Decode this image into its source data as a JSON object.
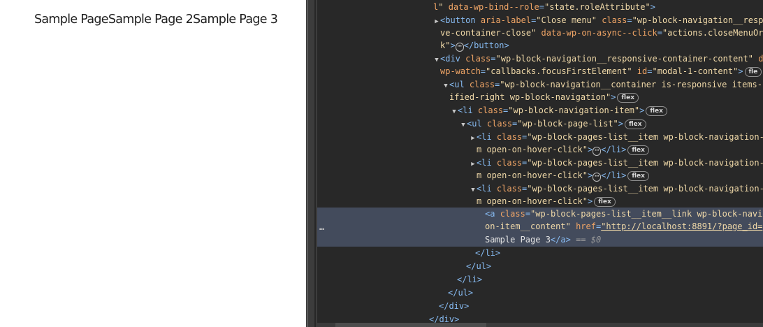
{
  "page_nav": {
    "items": [
      "Sample Page",
      "Sample Page 2",
      "Sample Page 3"
    ]
  },
  "devtools": {
    "lines": [
      {
        "text": "l\" data-wp-bind--role=\"state.roleAttribute\">"
      },
      {
        "text": "<button aria-label=\"Close menu\" class=\"wp-block-navigation__resp"
      },
      {
        "text": "ve-container-close\" data-wp-on-async--click=\"actions.closeMenuOr"
      },
      {
        "text": "k\">"
      },
      {
        "text": "</button>"
      },
      {
        "text": "<div class=\"wp-block-navigation__responsive-container-content\" d"
      },
      {
        "text": "wp-watch=\"callbacks.focusFirstElement\" id=\"modal-1-content\">"
      },
      {
        "text": "<ul class=\"wp-block-navigation__container is-responsive items-"
      },
      {
        "text": "ified-right wp-block-navigation\">"
      },
      {
        "text": "<li class=\"wp-block-navigation-item\">"
      },
      {
        "text": "<ul class=\"wp-block-page-list\">"
      },
      {
        "text": "<li class=\"wp-block-pages-list__item wp-block-navigation-"
      },
      {
        "text": "m open-on-hover-click\">"
      },
      {
        "text": "</li>"
      },
      {
        "text": "<a class=\"wp-block-pages-list__item__link wp-block-navi"
      },
      {
        "text": "on-item__content\" href=\"http://localhost:8891/?page_id="
      },
      {
        "text": "Sample Page 3"
      },
      {
        "text": "</a>"
      },
      {
        "text": "== $0"
      },
      {
        "text": "</li>"
      },
      {
        "text": "</ul>"
      },
      {
        "text": "</div>"
      }
    ],
    "badges": {
      "flex": "flex",
      "flex_truncated": "fle"
    },
    "ellipsis": "⋯",
    "selected_gutter": "…"
  },
  "colors": {
    "tag": "#87bbf2",
    "attr_name": "#f0a566",
    "attr_value": "#f0d9a8",
    "devtools_bg": "#282828",
    "selected_row": "#434b5c"
  }
}
